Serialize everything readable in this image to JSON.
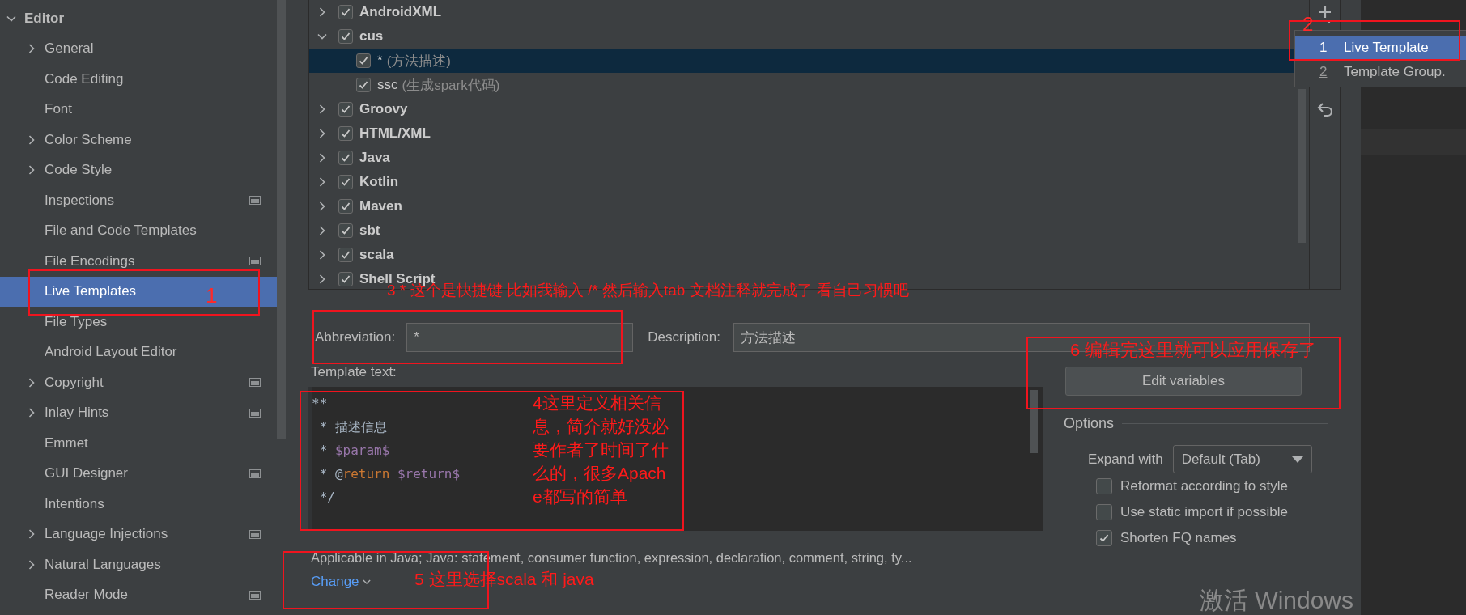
{
  "sidebar": {
    "items": [
      {
        "label": "Editor",
        "kind": "group",
        "expanded": true,
        "selected": false,
        "scope_icon": false,
        "children": [
          {
            "label": "General",
            "kind": "group",
            "expanded": false,
            "selected": false,
            "scope_icon": false
          },
          {
            "label": "Code Editing",
            "kind": "leaf",
            "selected": false,
            "scope_icon": false
          },
          {
            "label": "Font",
            "kind": "leaf",
            "selected": false,
            "scope_icon": false
          },
          {
            "label": "Color Scheme",
            "kind": "group",
            "expanded": false,
            "selected": false,
            "scope_icon": false
          },
          {
            "label": "Code Style",
            "kind": "group",
            "expanded": false,
            "selected": false,
            "scope_icon": false
          },
          {
            "label": "Inspections",
            "kind": "leaf",
            "selected": false,
            "scope_icon": true
          },
          {
            "label": "File and Code Templates",
            "kind": "leaf",
            "selected": false,
            "scope_icon": false
          },
          {
            "label": "File Encodings",
            "kind": "leaf",
            "selected": false,
            "scope_icon": true
          },
          {
            "label": "Live Templates",
            "kind": "leaf",
            "selected": true,
            "scope_icon": false
          },
          {
            "label": "File Types",
            "kind": "leaf",
            "selected": false,
            "scope_icon": false
          },
          {
            "label": "Android Layout Editor",
            "kind": "leaf",
            "selected": false,
            "scope_icon": false
          },
          {
            "label": "Copyright",
            "kind": "group",
            "expanded": false,
            "selected": false,
            "scope_icon": true
          },
          {
            "label": "Inlay Hints",
            "kind": "group",
            "expanded": false,
            "selected": false,
            "scope_icon": true
          },
          {
            "label": "Emmet",
            "kind": "leaf",
            "selected": false,
            "scope_icon": false
          },
          {
            "label": "GUI Designer",
            "kind": "leaf",
            "selected": false,
            "scope_icon": true
          },
          {
            "label": "Intentions",
            "kind": "leaf",
            "selected": false,
            "scope_icon": false
          },
          {
            "label": "Language Injections",
            "kind": "group",
            "expanded": false,
            "selected": false,
            "scope_icon": true
          },
          {
            "label": "Natural Languages",
            "kind": "group",
            "expanded": false,
            "selected": false,
            "scope_icon": false
          },
          {
            "label": "Reader Mode",
            "kind": "leaf",
            "selected": false,
            "scope_icon": true
          }
        ]
      }
    ]
  },
  "template_tree": {
    "groups": [
      {
        "name": "AndroidXML",
        "checked": true,
        "expanded": false
      },
      {
        "name": "cus",
        "checked": true,
        "expanded": true,
        "children": [
          {
            "abbreviation": "*",
            "description": "(方法描述)",
            "checked": true,
            "selected": true
          },
          {
            "abbreviation": "ssc",
            "description": "(生成spark代码)",
            "checked": true,
            "selected": false
          }
        ]
      },
      {
        "name": "Groovy",
        "checked": true,
        "expanded": false
      },
      {
        "name": "HTML/XML",
        "checked": true,
        "expanded": false
      },
      {
        "name": "Java",
        "checked": true,
        "expanded": false
      },
      {
        "name": "Kotlin",
        "checked": true,
        "expanded": false
      },
      {
        "name": "Maven",
        "checked": true,
        "expanded": false
      },
      {
        "name": "sbt",
        "checked": true,
        "expanded": false
      },
      {
        "name": "scala",
        "checked": true,
        "expanded": false
      },
      {
        "name": "Shell Script",
        "checked": true,
        "expanded": false
      }
    ]
  },
  "add_menu": {
    "items": [
      {
        "number": "1",
        "label": "Live Template",
        "selected": true
      },
      {
        "number": "2",
        "label": "Template Group.",
        "selected": false
      }
    ]
  },
  "form": {
    "abbreviation": {
      "label": "Abbreviation:",
      "value": "*"
    },
    "description": {
      "label": "Description:",
      "value": "方法描述"
    },
    "template_text": {
      "label": "Template text:",
      "lines": [
        [
          {
            "kind": "plain",
            "text": "**"
          }
        ],
        [
          {
            "kind": "plain",
            "text": " * 描述信息"
          }
        ],
        [
          {
            "kind": "plain",
            "text": " * "
          },
          {
            "kind": "variable",
            "text": "$param$"
          }
        ],
        [
          {
            "kind": "plain",
            "text": " * @"
          },
          {
            "kind": "keyword",
            "text": "return"
          },
          {
            "kind": "variable",
            "text": " $return$"
          }
        ],
        [
          {
            "kind": "plain",
            "text": " */"
          }
        ]
      ]
    },
    "applicable": "Applicable in Java; Java: statement, consumer function, expression, declaration, comment, string, ty...",
    "change_link": "Change",
    "edit_variables": "Edit variables",
    "options": {
      "title": "Options",
      "expand_label": "Expand with",
      "expand_value": "Default (Tab)",
      "checkboxes": [
        {
          "label": "Reformat according to style",
          "checked": false
        },
        {
          "label": "Use static import if possible",
          "checked": false
        },
        {
          "label": "Shorten FQ names",
          "checked": true
        }
      ]
    }
  },
  "annotations": [
    {
      "kind": "frame"
    },
    {
      "kind": "note",
      "text": "1"
    },
    {
      "kind": "frame"
    },
    {
      "kind": "note",
      "text": "2"
    },
    {
      "kind": "note",
      "text": "3 * 这个是快捷键 比如我输入 /* 然后输入tab 文档注释就完成了 看自己习惯吧"
    },
    {
      "kind": "frame"
    },
    {
      "kind": "frame"
    },
    {
      "kind": "note",
      "text": "4这里定义相关信息，简介就好没必要作者了时间了什么的，很多Apache都写的简单"
    },
    {
      "kind": "frame"
    },
    {
      "kind": "note",
      "text": "5 这里选择scala 和 java"
    },
    {
      "kind": "frame"
    },
    {
      "kind": "note",
      "text": "6 编辑完这里就可以应用保存了"
    }
  ],
  "system_watermark": "激活 Windows"
}
